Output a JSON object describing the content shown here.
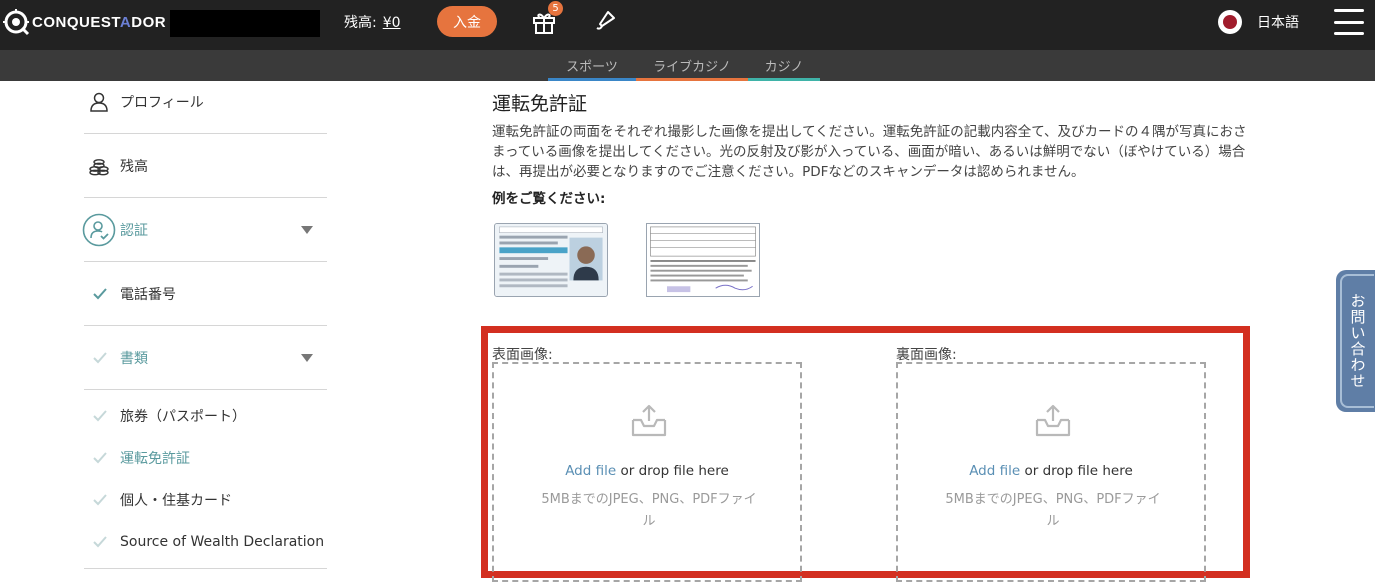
{
  "header": {
    "logo_text_a": "CONQUEST",
    "logo_text_b": "A",
    "logo_text_c": "DOR",
    "balance_label": "残高:",
    "balance_value": "¥0",
    "deposit_label": "入金",
    "gift_badge": "5",
    "language_label": "日本語"
  },
  "subnav": {
    "tabs": [
      {
        "label": "スポーツ",
        "color": "#3a86c7"
      },
      {
        "label": "ライブカジノ",
        "color": "#e6743e"
      },
      {
        "label": "カジノ",
        "color": "#3fb3a8"
      }
    ]
  },
  "sidebar": {
    "profile": "プロフィール",
    "balance": "残高",
    "verification": "認証",
    "phone": "電話番号",
    "documents": "書類",
    "passport": "旅券（パスポート）",
    "drivers_license": "運転免許証",
    "personal_card": "個人・住基カード",
    "source_of_wealth": "Source of Wealth Declaration"
  },
  "main": {
    "title": "運転免許証",
    "description": "運転免許証の両面をそれぞれ撮影した画像を提出してください。運転免許証の記載内容全て、及びカードの４隅が写真におさまっている画像を提出してください。光の反射及び影が入っている、画面が暗い、あるいは鮮明でない（ぼやけている）場合は、再提出が必要となりますのでご注意ください。PDFなどのスキャンデータは認められません。",
    "example_label": "例をご覧ください:",
    "front": {
      "label": "表面画像:",
      "add_file": "Add file",
      "drop_text": " or drop file here",
      "hint": "5MBまでのJPEG、PNG、PDFファイル"
    },
    "back": {
      "label": "裏面画像:",
      "add_file": "Add file",
      "drop_text": " or drop file here",
      "hint": "5MBまでのJPEG、PNG、PDFファイル"
    }
  },
  "contact_label": "お問い合わせ",
  "colors": {
    "accent_orange": "#e6743e",
    "teal": "#5a9a9e",
    "highlight_red": "#d32f20",
    "link_blue": "#5a8fb4"
  }
}
